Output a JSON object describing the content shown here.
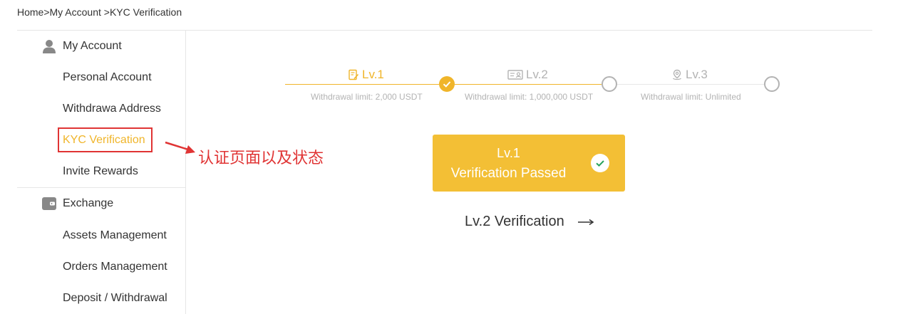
{
  "breadcrumb": "Home>My Account >KYC Verification",
  "sidebar": {
    "account_section": {
      "label": "My Account",
      "icon": "user-icon"
    },
    "account_items": [
      {
        "label": "Personal Account"
      },
      {
        "label": "Withdrawa Address"
      },
      {
        "label": "KYC Verification"
      },
      {
        "label": "Invite Rewards"
      }
    ],
    "exchange_section": {
      "label": "Exchange",
      "icon": "wallet-icon"
    },
    "exchange_items": [
      {
        "label": "Assets Management"
      },
      {
        "label": "Orders Management"
      },
      {
        "label": "Deposit / Withdrawal"
      }
    ]
  },
  "annotation": {
    "text": "认证页面以及状态",
    "color": "#e03434"
  },
  "progress": {
    "steps": [
      {
        "label": "Lv.1",
        "limit": "Withdrawal limit: 2,000 USDT",
        "icon": "document-edit-icon",
        "status": "done"
      },
      {
        "label": "Lv.2",
        "limit": "Withdrawal limit: 1,000,000 USDT",
        "icon": "id-card-icon",
        "status": "pending"
      },
      {
        "label": "Lv.3",
        "limit": "Withdrawal limit: Unlimited",
        "icon": "location-pin-icon",
        "status": "pending"
      }
    ]
  },
  "status_card": {
    "level": "Lv.1",
    "message": "Verification Passed"
  },
  "next_link": {
    "label": "Lv.2 Verification"
  },
  "colors": {
    "accent": "#f0b52a",
    "card": "#f3bf35",
    "annotation": "#e03434",
    "inactive": "#b3b3b3"
  }
}
